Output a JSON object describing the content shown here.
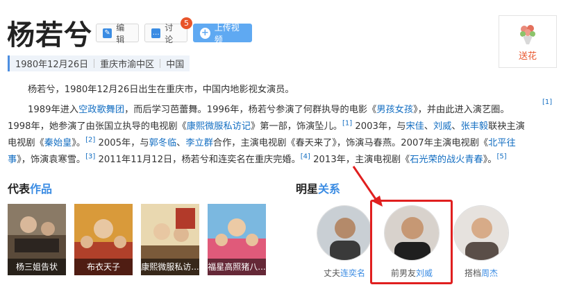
{
  "header": {
    "name": "杨若兮",
    "edit_label": "编辑",
    "discuss_label": "讨论",
    "discuss_count": "5",
    "upload_label": "上传视频",
    "gift_label": "送花"
  },
  "infobar": {
    "items": [
      "1980年12月26日",
      "重庆市渝中区",
      "中国"
    ]
  },
  "intro": {
    "summary": "杨若兮，1980年12月26日出生在重庆市，中国内地影视女演员。",
    "l1a": "1989年进入",
    "l1b": "空政歌舞团",
    "l1c": "，而后学习芭蕾舞。1996年，杨若兮参演了何群执导的电影《",
    "l1d": "男孩女孩",
    "l1e": "》，并由此进入演艺圈。",
    "s1": "[1]",
    "l2a": "1998年，她参演了由张国立执导的电视剧《",
    "l2b": "康熙微服私访记",
    "l2c": "》第一部，饰演坠儿。",
    "s2": "[1]",
    "l2d": "2003年，与",
    "l2e": "宋佳",
    "l2f": "、",
    "l2g": "刘威",
    "l2h": "、",
    "l2i": "张丰毅",
    "l2j": "联袂主演",
    "l3a": "电视剧《",
    "l3b": "秦始皇",
    "l3c": "》。",
    "s3": "[2]",
    "l3d": "2005年，与",
    "l3e": "郭冬临",
    "l3f": "、",
    "l3g": "李立群",
    "l3h": "合作，主演电视剧《春天来了》，饰演马春燕。2007年主演电视剧《",
    "l3i": "北平往",
    "l4a": "事",
    "l4b": "》，饰演袁寒雪。",
    "s4": "[3]",
    "l4c": "2011年11月12日，杨若兮和连奕名在重庆完婚。",
    "s5": "[4]",
    "l4d": "2013年，主演电视剧《",
    "l4e": "石光荣的战火青春",
    "l4f": "》。",
    "s6": "[5]"
  },
  "works": {
    "title_a": "代表",
    "title_b": "作品",
    "items": [
      {
        "label": "杨三姐告状"
      },
      {
        "label": "布衣天子"
      },
      {
        "label": "康熙微服私访..."
      },
      {
        "label": "福星高照猪八..."
      }
    ]
  },
  "relations": {
    "title_a": "明星",
    "title_b": "关系",
    "items": [
      {
        "relation": "丈夫",
        "name": "连奕名"
      },
      {
        "relation": "前男友",
        "name": "刘威"
      },
      {
        "relation": "搭档",
        "name": "周杰"
      }
    ]
  },
  "colors": {
    "link": "#136ec2",
    "accent": "#3b8ce3",
    "highlight": "#e01f1f",
    "badge": "#e8542a"
  }
}
